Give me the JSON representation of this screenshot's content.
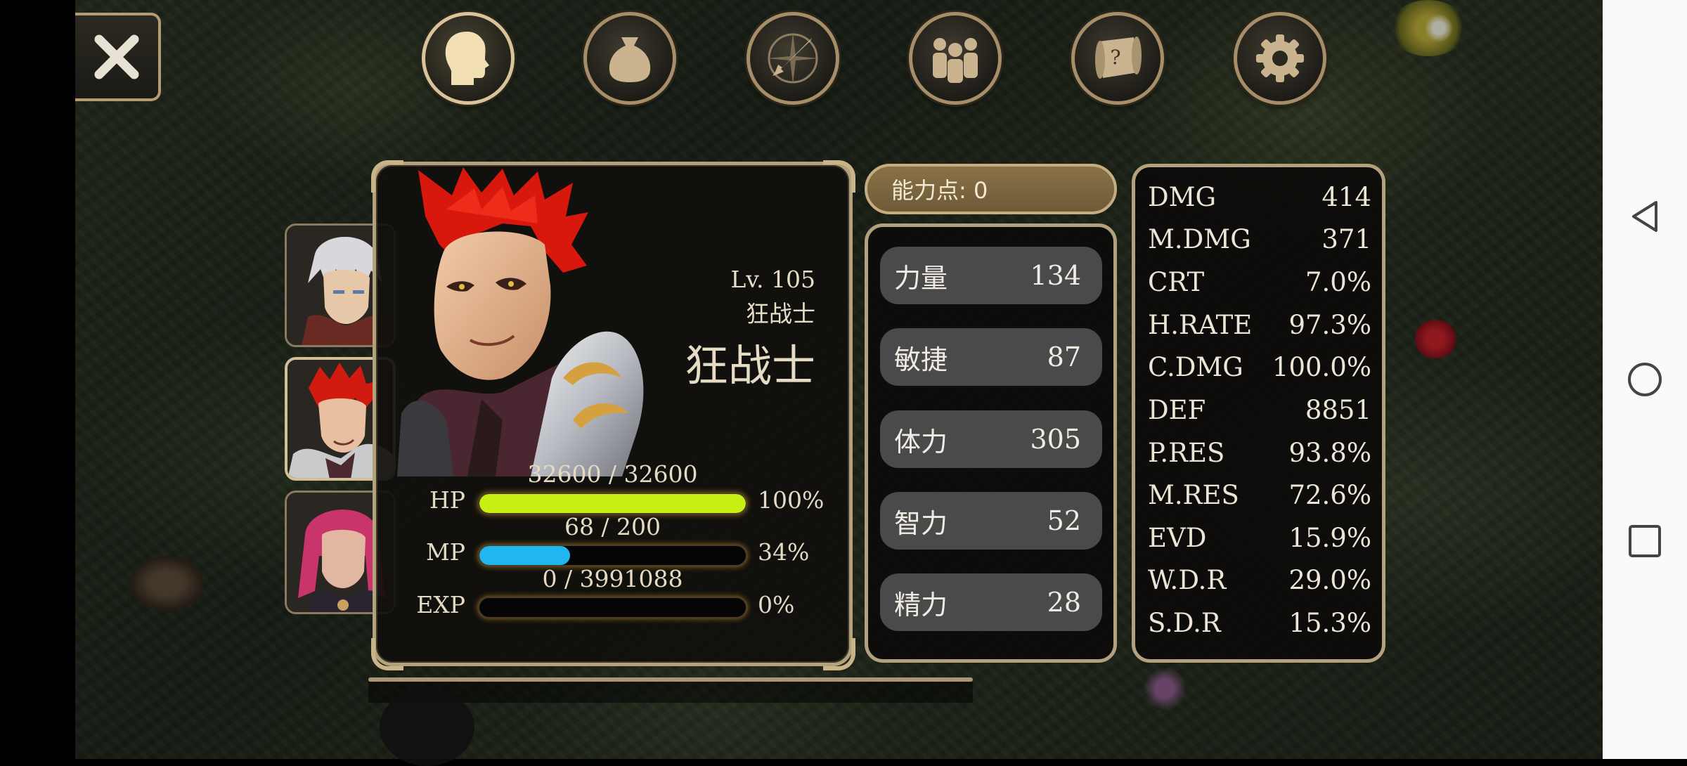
{
  "character": {
    "level": "Lv. 105",
    "class_small": "狂战士",
    "class_large": "狂战士"
  },
  "bars": {
    "hp": {
      "label": "HP",
      "value": "32600 / 32600",
      "percent": "100%",
      "fraction": 1.0,
      "color": "#c6f014"
    },
    "mp": {
      "label": "MP",
      "value": "68 / 200",
      "percent": "34%",
      "fraction": 0.34,
      "color": "#22b6ee"
    },
    "exp": {
      "label": "EXP",
      "value": "0 / 3991088",
      "percent": "0%",
      "fraction": 0.0,
      "color": "#d08a20"
    }
  },
  "ability_points": "能力点: 0",
  "attributes": [
    {
      "name": "力量",
      "value": "134"
    },
    {
      "name": "敏捷",
      "value": "87"
    },
    {
      "name": "体力",
      "value": "305"
    },
    {
      "name": "智力",
      "value": "52"
    },
    {
      "name": "精力",
      "value": "28"
    }
  ],
  "stats": [
    {
      "name": "DMG",
      "value": "414"
    },
    {
      "name": "M.DMG",
      "value": "371"
    },
    {
      "name": "CRT",
      "value": "7.0%"
    },
    {
      "name": "H.RATE",
      "value": "97.3%"
    },
    {
      "name": "C.DMG",
      "value": "100.0%"
    },
    {
      "name": "DEF",
      "value": "8851"
    },
    {
      "name": "P.RES",
      "value": "93.8%"
    },
    {
      "name": "M.RES",
      "value": "72.6%"
    },
    {
      "name": "EVD",
      "value": "15.9%"
    },
    {
      "name": "W.D.R",
      "value": "29.0%"
    },
    {
      "name": "S.D.R",
      "value": "15.3%"
    }
  ],
  "tabs": [
    {
      "id": "character",
      "icon": "head-icon",
      "active": true
    },
    {
      "id": "inventory",
      "icon": "bag-icon",
      "active": false
    },
    {
      "id": "skills",
      "icon": "sword-compass-icon",
      "active": false
    },
    {
      "id": "party",
      "icon": "group-icon",
      "active": false
    },
    {
      "id": "quest",
      "icon": "scroll-icon",
      "active": false
    },
    {
      "id": "settings",
      "icon": "gear-icon",
      "active": false
    }
  ],
  "party_members": [
    {
      "id": "white-haired-hero",
      "selected": false
    },
    {
      "id": "red-haired-berserker",
      "selected": true
    },
    {
      "id": "pink-haired-heroine",
      "selected": false
    }
  ],
  "colors": {
    "frame": "#b3a07c",
    "panel": "#100f0d",
    "ability_header": "#7e6842",
    "attr_row": "#4a4a4a"
  }
}
